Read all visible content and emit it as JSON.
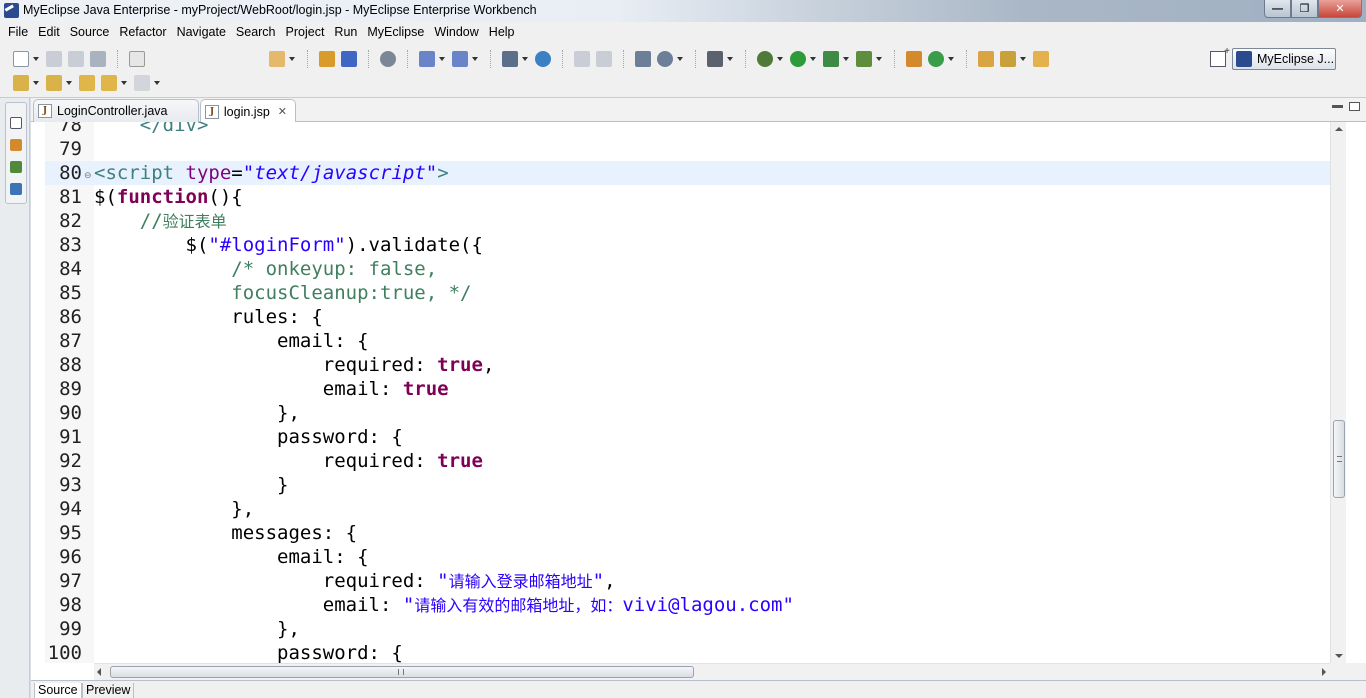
{
  "window": {
    "title": "MyEclipse Java Enterprise - myProject/WebRoot/login.jsp - MyEclipse Enterprise Workbench",
    "controls": [
      "minimize",
      "maximize",
      "close"
    ]
  },
  "menu": {
    "items": [
      "File",
      "Edit",
      "Source",
      "Refactor",
      "Navigate",
      "Search",
      "Project",
      "Run",
      "MyEclipse",
      "Window",
      "Help"
    ]
  },
  "perspective": {
    "label": "MyEclipse J..."
  },
  "editor": {
    "tabs": [
      {
        "label": "LoginController.java",
        "icon": "J",
        "active": false
      },
      {
        "label": "login.jsp",
        "icon": "J",
        "active": true,
        "close": "✕"
      }
    ],
    "bottom_tabs": [
      "Source",
      "Preview"
    ],
    "colors": {
      "tag": "#3f7f7f",
      "attribute": "#7f007f",
      "string": "#2a00ff",
      "keyword": "#7f0055",
      "comment": "#3f7f5f",
      "current_line": "#e8f2fe"
    },
    "lines": [
      {
        "n": "78",
        "tokens": [
          {
            "t": "    </div>",
            "c": "tag"
          }
        ]
      },
      {
        "n": "79",
        "tokens": []
      },
      {
        "n": "80",
        "fold": "⊖",
        "current": true,
        "tokens": [
          {
            "t": "<script",
            "c": "tag"
          },
          {
            "t": " "
          },
          {
            "t": "type",
            "c": "attr"
          },
          {
            "t": "="
          },
          {
            "t": "\"text/javascript\"",
            "c": "str"
          },
          {
            "t": ">",
            "c": "tag"
          }
        ]
      },
      {
        "n": "81",
        "tokens": [
          {
            "t": "$("
          },
          {
            "t": "function",
            "c": "kw"
          },
          {
            "t": "(){"
          }
        ]
      },
      {
        "n": "82",
        "tokens": [
          {
            "t": "    //",
            "c": "cm"
          },
          {
            "t": "验证表单",
            "c": "cm cjk"
          }
        ]
      },
      {
        "n": "83",
        "tokens": [
          {
            "t": "        $("
          },
          {
            "t": "\"#loginForm\"",
            "c": "jsstr"
          },
          {
            "t": ").validate({"
          }
        ]
      },
      {
        "n": "84",
        "tokens": [
          {
            "t": "            /* onkeyup: false,",
            "c": "cm"
          }
        ]
      },
      {
        "n": "85",
        "tokens": [
          {
            "t": "            focusCleanup:true, */",
            "c": "cm"
          }
        ]
      },
      {
        "n": "86",
        "tokens": [
          {
            "t": "            rules: {"
          }
        ]
      },
      {
        "n": "87",
        "tokens": [
          {
            "t": "                email: {"
          }
        ]
      },
      {
        "n": "88",
        "tokens": [
          {
            "t": "                    required: "
          },
          {
            "t": "true",
            "c": "kw"
          },
          {
            "t": ","
          }
        ]
      },
      {
        "n": "89",
        "tokens": [
          {
            "t": "                    email: "
          },
          {
            "t": "true",
            "c": "kw"
          }
        ]
      },
      {
        "n": "90",
        "tokens": [
          {
            "t": "                },"
          }
        ]
      },
      {
        "n": "91",
        "tokens": [
          {
            "t": "                password: {"
          }
        ]
      },
      {
        "n": "92",
        "tokens": [
          {
            "t": "                    required: "
          },
          {
            "t": "true",
            "c": "kw"
          }
        ]
      },
      {
        "n": "93",
        "tokens": [
          {
            "t": "                }"
          }
        ]
      },
      {
        "n": "94",
        "tokens": [
          {
            "t": "            },"
          }
        ]
      },
      {
        "n": "95",
        "tokens": [
          {
            "t": "            messages: {"
          }
        ]
      },
      {
        "n": "96",
        "tokens": [
          {
            "t": "                email: {"
          }
        ]
      },
      {
        "n": "97",
        "tokens": [
          {
            "t": "                    required: "
          },
          {
            "t": "\"",
            "c": "jsstr"
          },
          {
            "t": "请输入登录邮箱地址",
            "c": "jsstr cjk"
          },
          {
            "t": "\"",
            "c": "jsstr"
          },
          {
            "t": ","
          }
        ]
      },
      {
        "n": "98",
        "tokens": [
          {
            "t": "                    email: "
          },
          {
            "t": "\"",
            "c": "jsstr"
          },
          {
            "t": "请输入有效的邮箱地址，如：",
            "c": "jsstr cjk"
          },
          {
            "t": "vivi@lagou.com\"",
            "c": "jsstr"
          }
        ]
      },
      {
        "n": "99",
        "tokens": [
          {
            "t": "                },"
          }
        ]
      },
      {
        "n": "100",
        "tokens": [
          {
            "t": "                password: {"
          }
        ]
      }
    ]
  }
}
